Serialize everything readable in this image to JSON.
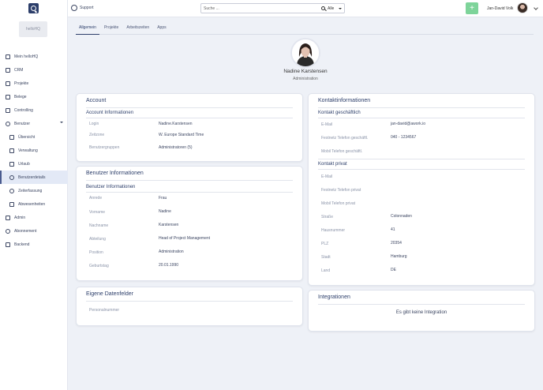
{
  "sidebar": {
    "company": "helloHQ",
    "items": [
      {
        "label": "Mein helloHQ"
      },
      {
        "label": "CRM"
      },
      {
        "label": "Projekte"
      },
      {
        "label": "Belege"
      },
      {
        "label": "Controlling"
      },
      {
        "label": "Benutzer"
      },
      {
        "label": "Übersicht"
      },
      {
        "label": "Verwaltung"
      },
      {
        "label": "Urlaub"
      },
      {
        "label": "Benutzerdetails"
      },
      {
        "label": "Zeiterfassung"
      },
      {
        "label": "Abwesenheiten"
      },
      {
        "label": "Admin"
      },
      {
        "label": "Abonnement"
      },
      {
        "label": "Backend"
      }
    ]
  },
  "topbar": {
    "support_label": "Support",
    "search_placeholder": "Suche ...",
    "search_scope": "Alle",
    "add_label": "+",
    "user_name": "Jan-David Volk"
  },
  "tabs": [
    "Allgemein",
    "Projekte",
    "Arbeitszeiten",
    "Apps"
  ],
  "profile": {
    "name": "Nadine Karstensen",
    "role": "Administration"
  },
  "account": {
    "title": "Account",
    "section": "Account Informationen",
    "rows": [
      {
        "label": "Login",
        "value": "Nadine.Karstensen"
      },
      {
        "label": "Zeitzone",
        "value": "W. Europe Standard Time"
      },
      {
        "label": "Benutzergruppen",
        "value": "Administratoren (5)"
      }
    ]
  },
  "benutzer": {
    "title": "Benutzer Informationen",
    "section": "Benutzer Informationen",
    "rows": [
      {
        "label": "Anrede",
        "value": "Frau"
      },
      {
        "label": "Vorname",
        "value": "Nadine"
      },
      {
        "label": "Nachname",
        "value": "Karstensen"
      },
      {
        "label": "Abteilung",
        "value": "Head of Project Management"
      },
      {
        "label": "Position",
        "value": "Administration"
      },
      {
        "label": "Geburtstag",
        "value": "20.01.1990"
      }
    ]
  },
  "eigene": {
    "title": "Eigene Datenfelder",
    "rows": [
      {
        "label": "Personalnummer",
        "value": ""
      }
    ]
  },
  "kontakt": {
    "title": "Kontaktinformationen",
    "business_section": "Kontakt geschäftlich",
    "business_rows": [
      {
        "label": "E-Mail",
        "value": "jan-david@awork.io"
      },
      {
        "label": "Festnetz Telefon geschäftl.",
        "value": "040 - 1234567"
      },
      {
        "label": "Mobil Telefon geschäftl.",
        "value": ""
      }
    ],
    "private_section": "Kontakt privat",
    "private_rows": [
      {
        "label": "E-Mail",
        "value": ""
      },
      {
        "label": "Festnetz Telefon privat",
        "value": ""
      },
      {
        "label": "Mobil Telefon privat",
        "value": ""
      },
      {
        "label": "Straße",
        "value": "Colonnaden"
      },
      {
        "label": "Hausnummer",
        "value": "41"
      },
      {
        "label": "PLZ",
        "value": "20354"
      },
      {
        "label": "Stadt",
        "value": "Hamburg"
      },
      {
        "label": "Land",
        "value": "DE"
      }
    ]
  },
  "integrationen": {
    "title": "Integrationen",
    "empty_message": "Es gibt keine Integration"
  }
}
